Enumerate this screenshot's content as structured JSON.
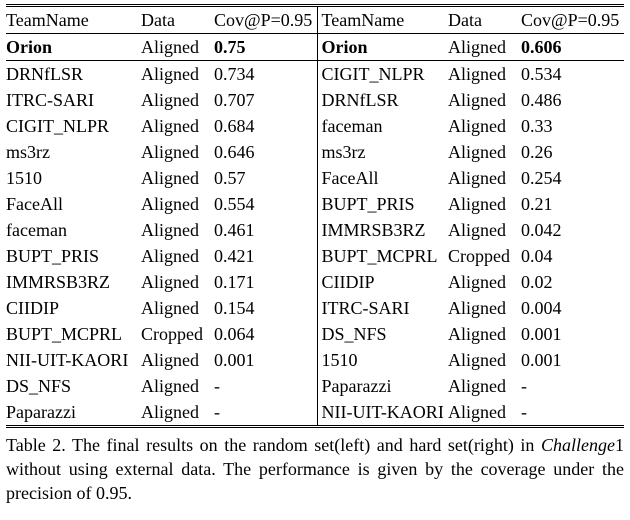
{
  "headers": {
    "team": "TeamName",
    "data": "Data",
    "cov": "Cov@P=0.95"
  },
  "left_top": {
    "team": "Orion",
    "data": "Aligned",
    "cov": "0.75"
  },
  "right_top": {
    "team": "Orion",
    "data": "Aligned",
    "cov": "0.606"
  },
  "left": [
    {
      "team": "DRNfLSR",
      "data": "Aligned",
      "cov": "0.734"
    },
    {
      "team": "ITRC-SARI",
      "data": "Aligned",
      "cov": "0.707"
    },
    {
      "team": "CIGIT_NLPR",
      "data": "Aligned",
      "cov": "0.684"
    },
    {
      "team": "ms3rz",
      "data": "Aligned",
      "cov": "0.646"
    },
    {
      "team": "1510",
      "data": "Aligned",
      "cov": "0.57"
    },
    {
      "team": "FaceAll",
      "data": "Aligned",
      "cov": "0.554"
    },
    {
      "team": "faceman",
      "data": "Aligned",
      "cov": "0.461"
    },
    {
      "team": "BUPT_PRIS",
      "data": "Aligned",
      "cov": "0.421"
    },
    {
      "team": "IMMRSB3RZ",
      "data": "Aligned",
      "cov": "0.171"
    },
    {
      "team": "CIIDIP",
      "data": "Aligned",
      "cov": "0.154"
    },
    {
      "team": "BUPT_MCPRL",
      "data": "Cropped",
      "cov": "0.064"
    },
    {
      "team": "NII-UIT-KAORI",
      "data": "Aligned",
      "cov": "0.001"
    },
    {
      "team": "DS_NFS",
      "data": "Aligned",
      "cov": "-"
    },
    {
      "team": "Paparazzi",
      "data": "Aligned",
      "cov": "-"
    }
  ],
  "right": [
    {
      "team": "CIGIT_NLPR",
      "data": "Aligned",
      "cov": "0.534"
    },
    {
      "team": "DRNfLSR",
      "data": "Aligned",
      "cov": "0.486"
    },
    {
      "team": "faceman",
      "data": "Aligned",
      "cov": "0.33"
    },
    {
      "team": "ms3rz",
      "data": "Aligned",
      "cov": "0.26"
    },
    {
      "team": "FaceAll",
      "data": "Aligned",
      "cov": "0.254"
    },
    {
      "team": "BUPT_PRIS",
      "data": "Aligned",
      "cov": "0.21"
    },
    {
      "team": "IMMRSB3RZ",
      "data": "Aligned",
      "cov": "0.042"
    },
    {
      "team": "BUPT_MCPRL",
      "data": "Cropped",
      "cov": "0.04"
    },
    {
      "team": "CIIDIP",
      "data": "Aligned",
      "cov": "0.02"
    },
    {
      "team": "ITRC-SARI",
      "data": "Aligned",
      "cov": "0.004"
    },
    {
      "team": "DS_NFS",
      "data": "Aligned",
      "cov": "0.001"
    },
    {
      "team": "1510",
      "data": "Aligned",
      "cov": "0.001"
    },
    {
      "team": "Paparazzi",
      "data": "Aligned",
      "cov": "-"
    },
    {
      "team": "NII-UIT-KAORI",
      "data": "Aligned",
      "cov": "-"
    }
  ],
  "caption_pre": "Table 2. The final results on the random set(left) and hard set(right) in ",
  "caption_math_c": "Challenge",
  "caption_math_n": "1",
  "caption_post": " without using external data. The performance is given by the coverage under the precision of ",
  "caption_num": "0.95",
  "caption_end": ".",
  "chart_data": {
    "type": "table",
    "title": "Table 2. Final results on random set (left) and hard set (right) in Challenge1 without external data.",
    "columns": [
      "TeamName",
      "Data",
      "Cov@P=0.95"
    ],
    "random_set": [
      [
        "Orion",
        "Aligned",
        0.75
      ],
      [
        "DRNfLSR",
        "Aligned",
        0.734
      ],
      [
        "ITRC-SARI",
        "Aligned",
        0.707
      ],
      [
        "CIGIT_NLPR",
        "Aligned",
        0.684
      ],
      [
        "ms3rz",
        "Aligned",
        0.646
      ],
      [
        "1510",
        "Aligned",
        0.57
      ],
      [
        "FaceAll",
        "Aligned",
        0.554
      ],
      [
        "faceman",
        "Aligned",
        0.461
      ],
      [
        "BUPT_PRIS",
        "Aligned",
        0.421
      ],
      [
        "IMMRSB3RZ",
        "Aligned",
        0.171
      ],
      [
        "CIIDIP",
        "Aligned",
        0.154
      ],
      [
        "BUPT_MCPRL",
        "Cropped",
        0.064
      ],
      [
        "NII-UIT-KAORI",
        "Aligned",
        0.001
      ],
      [
        "DS_NFS",
        "Aligned",
        null
      ],
      [
        "Paparazzi",
        "Aligned",
        null
      ]
    ],
    "hard_set": [
      [
        "Orion",
        "Aligned",
        0.606
      ],
      [
        "CIGIT_NLPR",
        "Aligned",
        0.534
      ],
      [
        "DRNfLSR",
        "Aligned",
        0.486
      ],
      [
        "faceman",
        "Aligned",
        0.33
      ],
      [
        "ms3rz",
        "Aligned",
        0.26
      ],
      [
        "FaceAll",
        "Aligned",
        0.254
      ],
      [
        "BUPT_PRIS",
        "Aligned",
        0.21
      ],
      [
        "IMMRSB3RZ",
        "Aligned",
        0.042
      ],
      [
        "BUPT_MCPRL",
        "Cropped",
        0.04
      ],
      [
        "CIIDIP",
        "Aligned",
        0.02
      ],
      [
        "ITRC-SARI",
        "Aligned",
        0.004
      ],
      [
        "DS_NFS",
        "Aligned",
        0.001
      ],
      [
        "1510",
        "Aligned",
        0.001
      ],
      [
        "Paparazzi",
        "Aligned",
        null
      ],
      [
        "NII-UIT-KAORI",
        "Aligned",
        null
      ]
    ]
  }
}
